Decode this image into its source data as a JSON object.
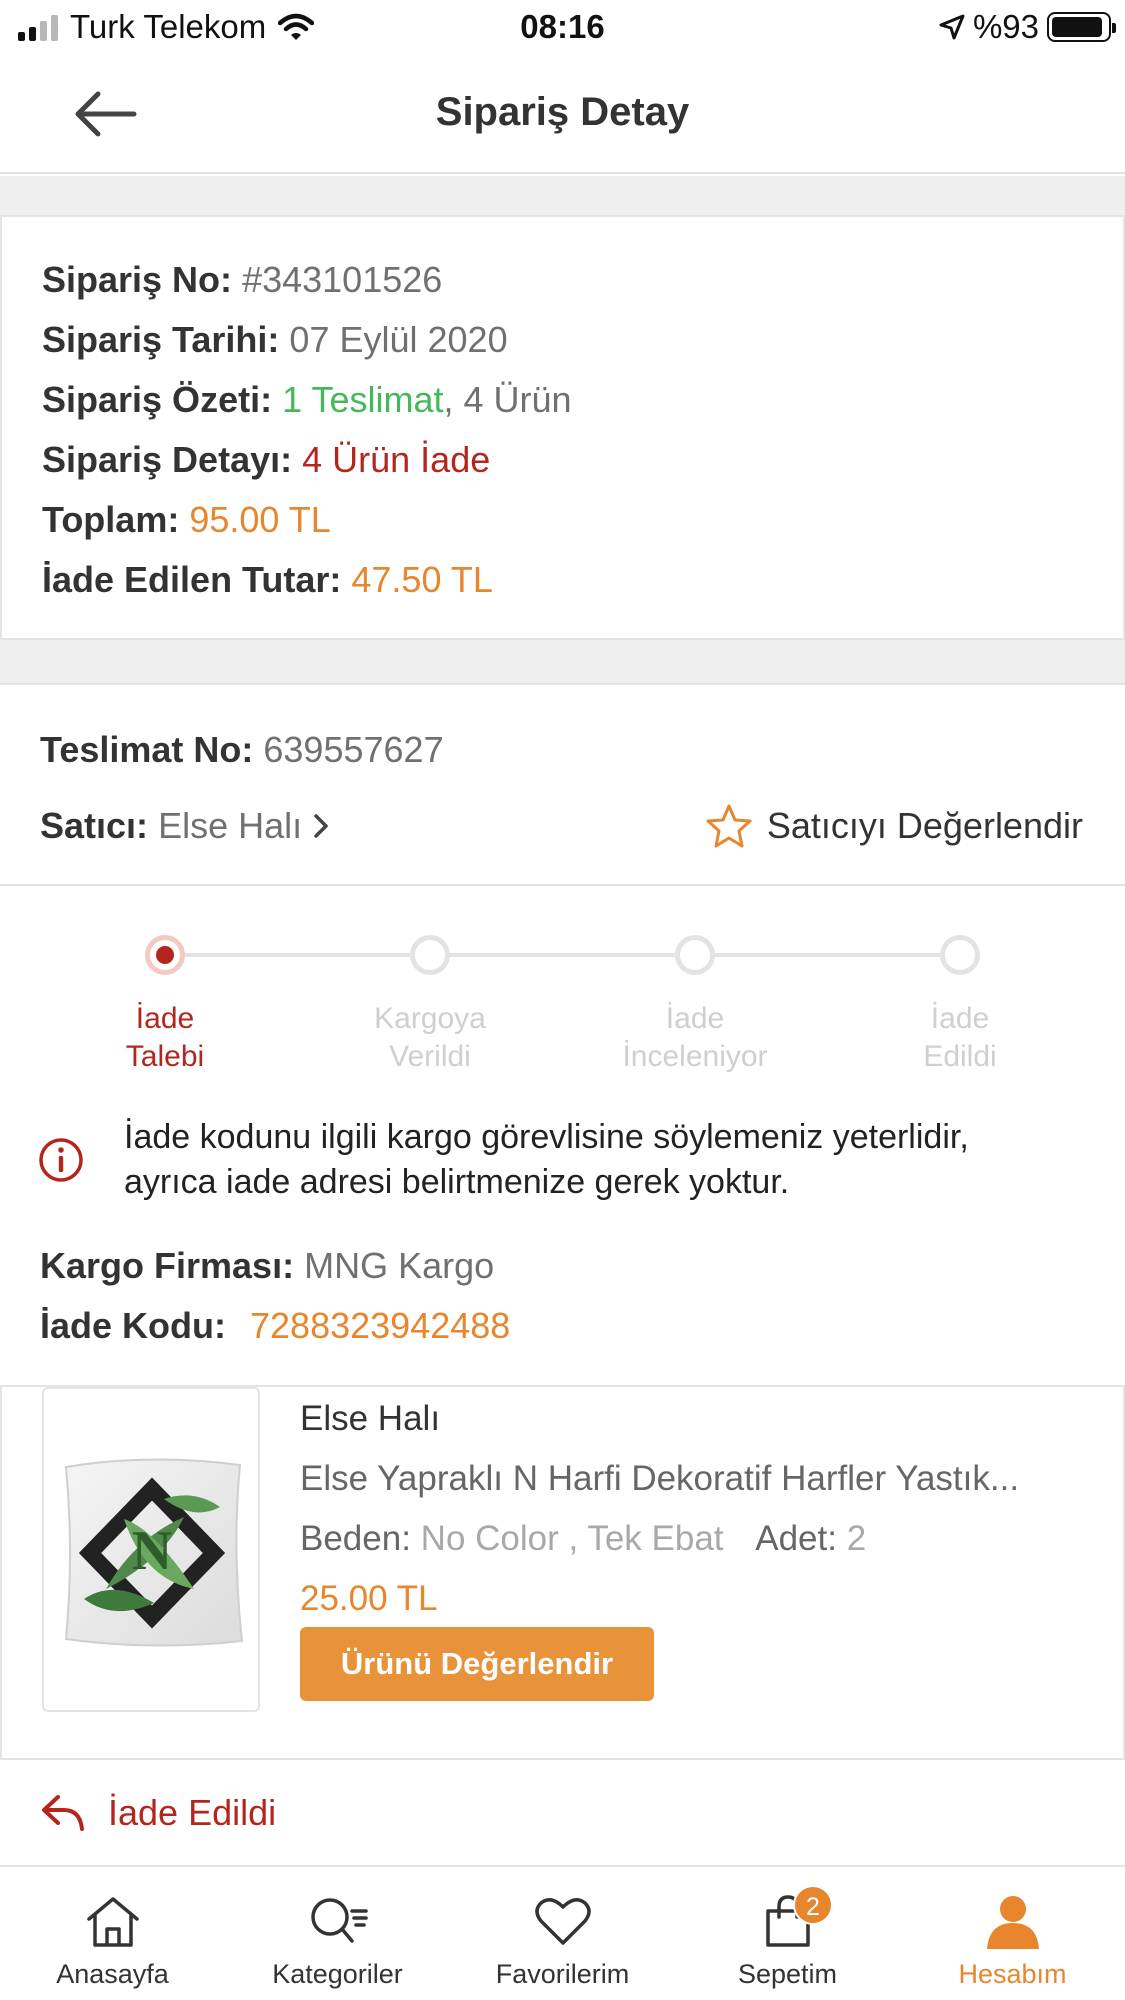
{
  "status_bar": {
    "carrier": "Turk Telekom",
    "time": "08:16",
    "battery": "%93",
    "battery_level": 0.93
  },
  "nav": {
    "title": "Sipariş Detay",
    "back_icon": "arrow-left-icon"
  },
  "summary": {
    "order_no_label": "Sipariş No:",
    "order_no": "#343101526",
    "order_date_label": "Sipariş Tarihi:",
    "order_date": "07 Eylül 2020",
    "overview_label": "Sipariş Özeti:",
    "overview_delivery": "1 Teslimat",
    "overview_sep": ",",
    "overview_items": "4 Ürün",
    "detail_label": "Sipariş Detayı:",
    "detail_value": "4 Ürün İade",
    "total_label": "Toplam:",
    "total_value": "95.00 TL",
    "refund_label": "İade Edilen Tutar:",
    "refund_value": "47.50 TL"
  },
  "delivery": {
    "delivery_no_label": "Teslimat No:",
    "delivery_no": "639557627",
    "seller_label": "Satıcı:",
    "seller_name": "Else Halı",
    "rate_seller_label": "Satıcıyı Değerlendir",
    "steps": [
      {
        "line1": "İade",
        "line2": "Talebi",
        "active": true
      },
      {
        "line1": "Kargoya",
        "line2": "Verildi",
        "active": false
      },
      {
        "line1": "İade",
        "line2": "İnceleniyor",
        "active": false
      },
      {
        "line1": "İade",
        "line2": "Edildi",
        "active": false
      }
    ],
    "info_line1": "İade kodunu ilgili kargo görevlisine söylemeniz yeterlidir,",
    "info_line2": "ayrıca iade adresi belirtmenize gerek yoktur.",
    "cargo_label": "Kargo Firması:",
    "cargo_value": "MNG Kargo",
    "return_code_label": "İade Kodu:",
    "return_code": "7288323942488"
  },
  "product": {
    "seller": "Else Halı",
    "name": "Else Yapraklı N Harfi Dekoratif Harfler Yastık...",
    "size_label": "Beden:",
    "size_value": "No Color , Tek Ebat",
    "qty_label": "Adet:",
    "qty_value": "2",
    "price": "25.00 TL",
    "rate_button": "Ürünü Değerlendir"
  },
  "returned": {
    "label": "İade Edildi",
    "icon": "reply-arrow-icon"
  },
  "tabbar": {
    "tabs": [
      {
        "label": "Anasayfa",
        "icon": "home-icon",
        "active": false
      },
      {
        "label": "Kategoriler",
        "icon": "search-list-icon",
        "active": false
      },
      {
        "label": "Favorilerim",
        "icon": "heart-icon",
        "active": false
      },
      {
        "label": "Sepetim",
        "icon": "shopping-bag-icon",
        "active": false,
        "badge": "2"
      },
      {
        "label": "Hesabım",
        "icon": "user-icon",
        "active": true
      }
    ]
  },
  "colors": {
    "accent_orange": "#e8862e",
    "return_red": "#b3261e",
    "success_green": "#45b85b",
    "button_orange": "#e8933a"
  }
}
